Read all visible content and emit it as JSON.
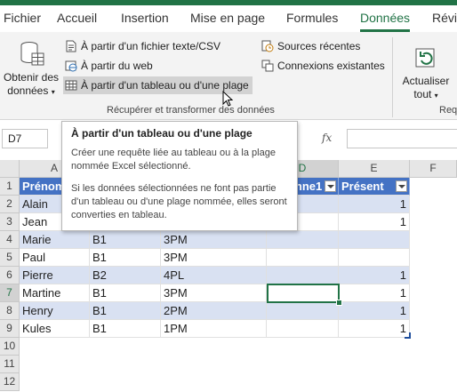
{
  "tabs": [
    "Fichier",
    "Accueil",
    "Insertion",
    "Mise en page",
    "Formules",
    "Données",
    "Révis"
  ],
  "active_tab": "Données",
  "ribbon": {
    "get_data_label_1": "Obtenir des",
    "get_data_label_2": "données",
    "from_text_csv": "À partir d'un fichier texte/CSV",
    "from_web": "À partir du web",
    "from_table": "À partir d'un tableau ou d'une plage",
    "recent_sources": "Sources récentes",
    "existing_connections": "Connexions existantes",
    "group_label": "Récupérer et transformer des données",
    "refresh_label_1": "Actualiser",
    "refresh_label_2": "tout",
    "next_group_label": "Req"
  },
  "formula_bar": {
    "name_box": "D7",
    "fx": "fx"
  },
  "columns": [
    "A",
    "B",
    "C",
    "D",
    "E",
    "F"
  ],
  "rows": [
    "1",
    "2",
    "3",
    "4",
    "5",
    "6",
    "7",
    "8",
    "9",
    "10",
    "11",
    "12"
  ],
  "table": {
    "headers": [
      "Prénom",
      "",
      "",
      "Colonne1",
      "Présent"
    ],
    "data": [
      [
        "Alain",
        "",
        "",
        "",
        "1"
      ],
      [
        "Jean",
        "",
        "",
        "",
        "1"
      ],
      [
        "Marie",
        "B1",
        "3PM",
        "",
        ""
      ],
      [
        "Paul",
        "B1",
        "3PM",
        "",
        ""
      ],
      [
        "Pierre",
        "B2",
        "4PL",
        "",
        "1"
      ],
      [
        "Martine",
        "B1",
        "3PM",
        "",
        "1"
      ],
      [
        "Henry",
        "B1",
        "2PM",
        "",
        "1"
      ],
      [
        "Kules",
        "B1",
        "1PM",
        "",
        "1"
      ]
    ]
  },
  "tooltip": {
    "title": "À partir d'un tableau ou d'une plage",
    "para1": "Créer une requête liée au tableau ou à la plage nommée Excel sélectionné.",
    "para2": "Si les données sélectionnées ne font pas partie d'un tableau ou d'une plage nommée, elles seront converties en tableau."
  },
  "colors": {
    "accent": "#217346",
    "table_header": "#4472c4",
    "table_band": "#d9e1f2"
  }
}
